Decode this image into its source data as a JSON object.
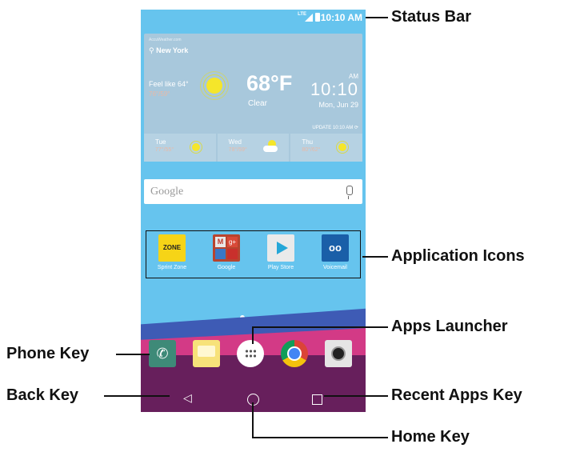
{
  "status_bar": {
    "network": "LTE",
    "time": "10:10 AM"
  },
  "weather": {
    "source": "AccuWeather.com",
    "location": "New York",
    "feels_like": "Feel like 64°",
    "hi_lo": "76°/59°",
    "temperature": "68°F",
    "condition": "Clear",
    "ampm": "AM",
    "clock": "10:10",
    "date": "Mon, Jun 29",
    "update": "UPDATE 10:10 AM ⟳",
    "forecast": [
      {
        "day": "Tue",
        "temp": "77°/55°",
        "icon": "sun-icon"
      },
      {
        "day": "Wed",
        "temp": "78°/59°",
        "icon": "partly-cloudy-icon"
      },
      {
        "day": "Thu",
        "temp": "80°/62°",
        "icon": "sun-icon"
      }
    ]
  },
  "search": {
    "placeholder": "Google"
  },
  "apps": [
    {
      "label": "Sprint Zone",
      "icon_text": "ZONE"
    },
    {
      "label": "Google",
      "icon_text": "M"
    },
    {
      "label": "Play Store",
      "icon_text": ""
    },
    {
      "label": "Voicemail",
      "icon_text": "oo"
    }
  ],
  "dock": {
    "phone": "phone-icon",
    "messaging": "messaging-icon",
    "apps_launcher": "apps-launcher-icon",
    "chrome": "chrome-icon",
    "camera": "camera-icon"
  },
  "navigation": {
    "back": "◁"
  },
  "callouts": {
    "status_bar": "Status Bar",
    "application_icons": "Application Icons",
    "apps_launcher": "Apps Launcher",
    "phone_key": "Phone Key",
    "back_key": "Back Key",
    "recent_apps_key": "Recent Apps Key",
    "home_key": "Home Key"
  }
}
